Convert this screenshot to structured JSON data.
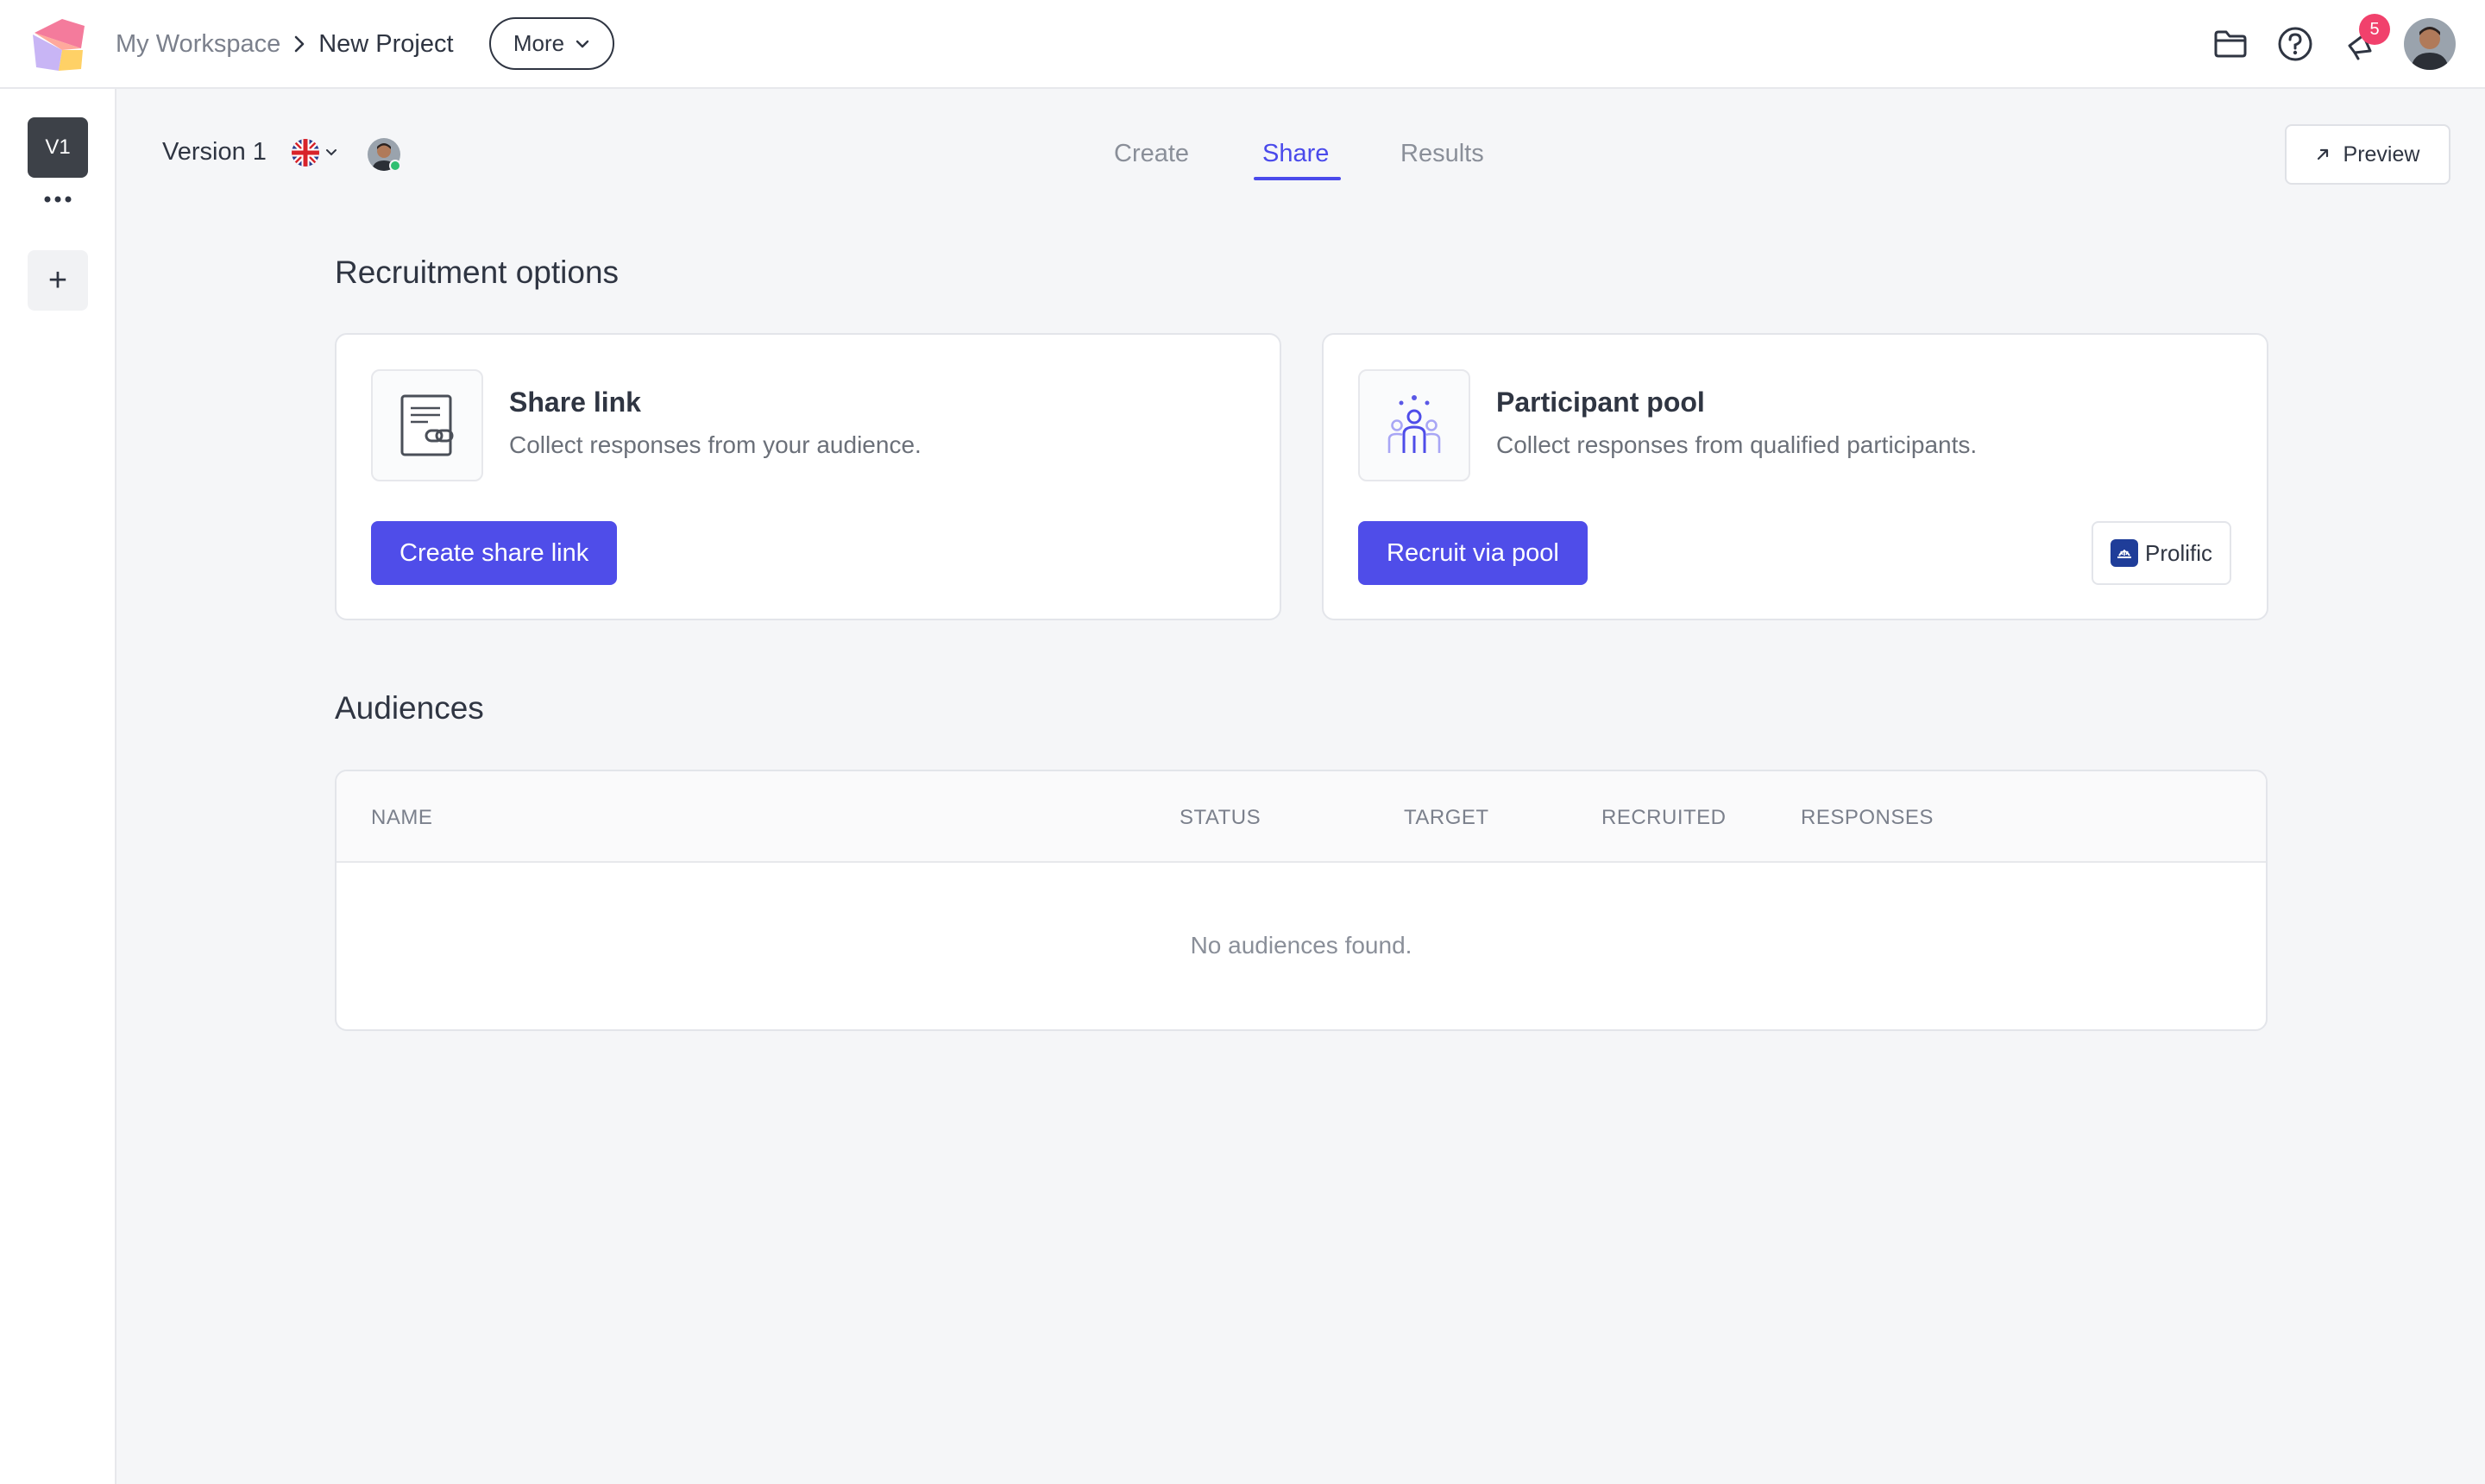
{
  "header": {
    "breadcrumb": {
      "workspace": "My Workspace",
      "project": "New Project"
    },
    "more_label": "More",
    "notification_count": "5"
  },
  "rail": {
    "version_badge": "V1",
    "add_label": "+"
  },
  "subheader": {
    "version_label": "Version 1",
    "language_flag": "uk-flag-icon",
    "tabs": [
      {
        "label": "Create",
        "active": false
      },
      {
        "label": "Share",
        "active": true
      },
      {
        "label": "Results",
        "active": false
      }
    ],
    "preview_label": "Preview"
  },
  "recruitment": {
    "title": "Recruitment options",
    "share_link": {
      "title": "Share link",
      "description": "Collect responses from your audience.",
      "button": "Create share link"
    },
    "participant_pool": {
      "title": "Participant pool",
      "description": "Collect responses from qualified participants.",
      "button": "Recruit via pool",
      "provider": "Prolific"
    }
  },
  "audiences": {
    "title": "Audiences",
    "columns": [
      "NAME",
      "STATUS",
      "TARGET",
      "RECRUITED",
      "RESPONSES"
    ],
    "empty_message": "No audiences found."
  },
  "colors": {
    "accent": "#4f4de9",
    "tab_active": "#4a4aeb",
    "badge": "#f1416c",
    "rail_badge": "#3d4148",
    "online": "#2fbf71"
  }
}
